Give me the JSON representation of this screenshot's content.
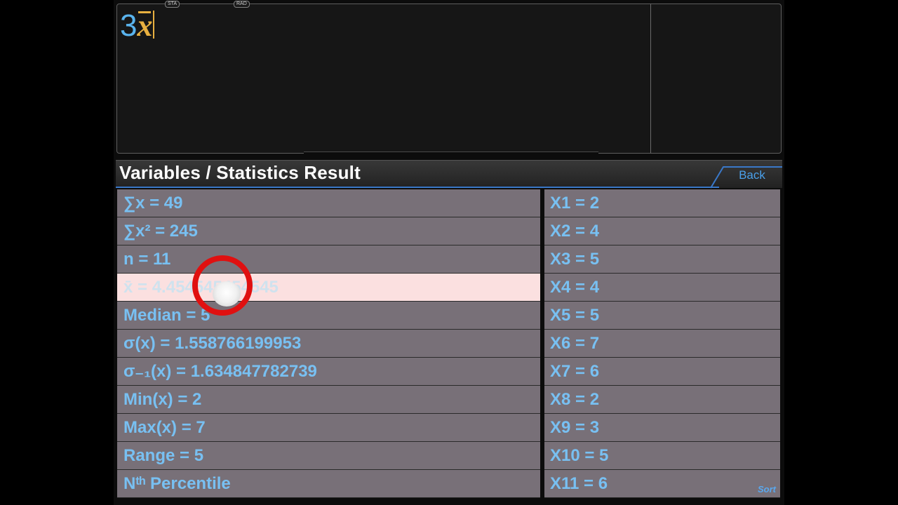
{
  "display": {
    "indicators": [
      "STA",
      "RAD"
    ],
    "expression_number": "3",
    "expression_variable": "x"
  },
  "header": {
    "title": "Variables / Statistics Result",
    "back_label": "Back"
  },
  "stats": [
    "∑x = 49",
    "∑x² = 245",
    "n = 11",
    "x̄ = 4.454545454545",
    "Median = 5",
    "σ(x) = 1.558766199953",
    "σ₋₁(x) = 1.634847782739",
    "Min(x) = 2",
    "Max(x) = 7",
    "Range = 5",
    "Nᵗʰ Percentile"
  ],
  "data_values": [
    "X1 = 2",
    "X2 = 4",
    "X3 = 5",
    "X4 = 4",
    "X5 = 5",
    "X6 = 7",
    "X7 = 6",
    "X8 = 2",
    "X9 = 3",
    "X10 = 5",
    "X11 = 6"
  ],
  "sort_label": "Sort",
  "colors": {
    "accent_blue": "#4aa0ea",
    "row_bg": "#787078",
    "selected_row_bg": "#fbe0e0",
    "touch_ring": "#e01010",
    "variable_gold": "#e8b040"
  }
}
